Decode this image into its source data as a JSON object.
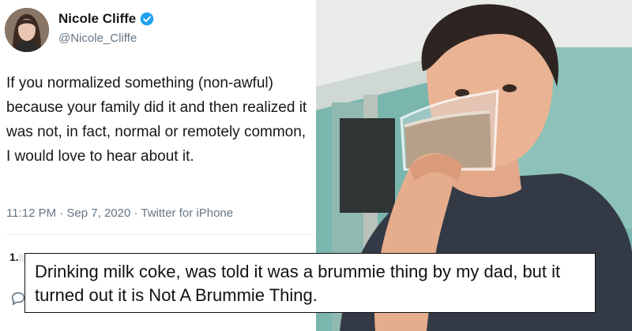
{
  "tweet": {
    "author_name": "Nicole Cliffe",
    "handle": "@Nicole_Cliffe",
    "text": "If you normalized something (non-awful) because your family did it and then realized it was not, in fact, normal or remotely common, I would love to hear about it.",
    "timestamp": "11:12 PM · Sep 7, 2020 · Twitter for iPhone",
    "count_partial": "1.",
    "icons": {
      "verified": "verified-badge-icon",
      "reply": "reply-icon"
    },
    "colors": {
      "name": "#14171a",
      "secondary": "#657786",
      "verified": "#1da1f2"
    }
  },
  "caption": {
    "text": "Drinking milk coke, was told it was a brummie thing by my dad, but it turned out it is Not A Brummie Thing."
  },
  "photo": {
    "subject": "man drinking milk coke from a glass"
  }
}
